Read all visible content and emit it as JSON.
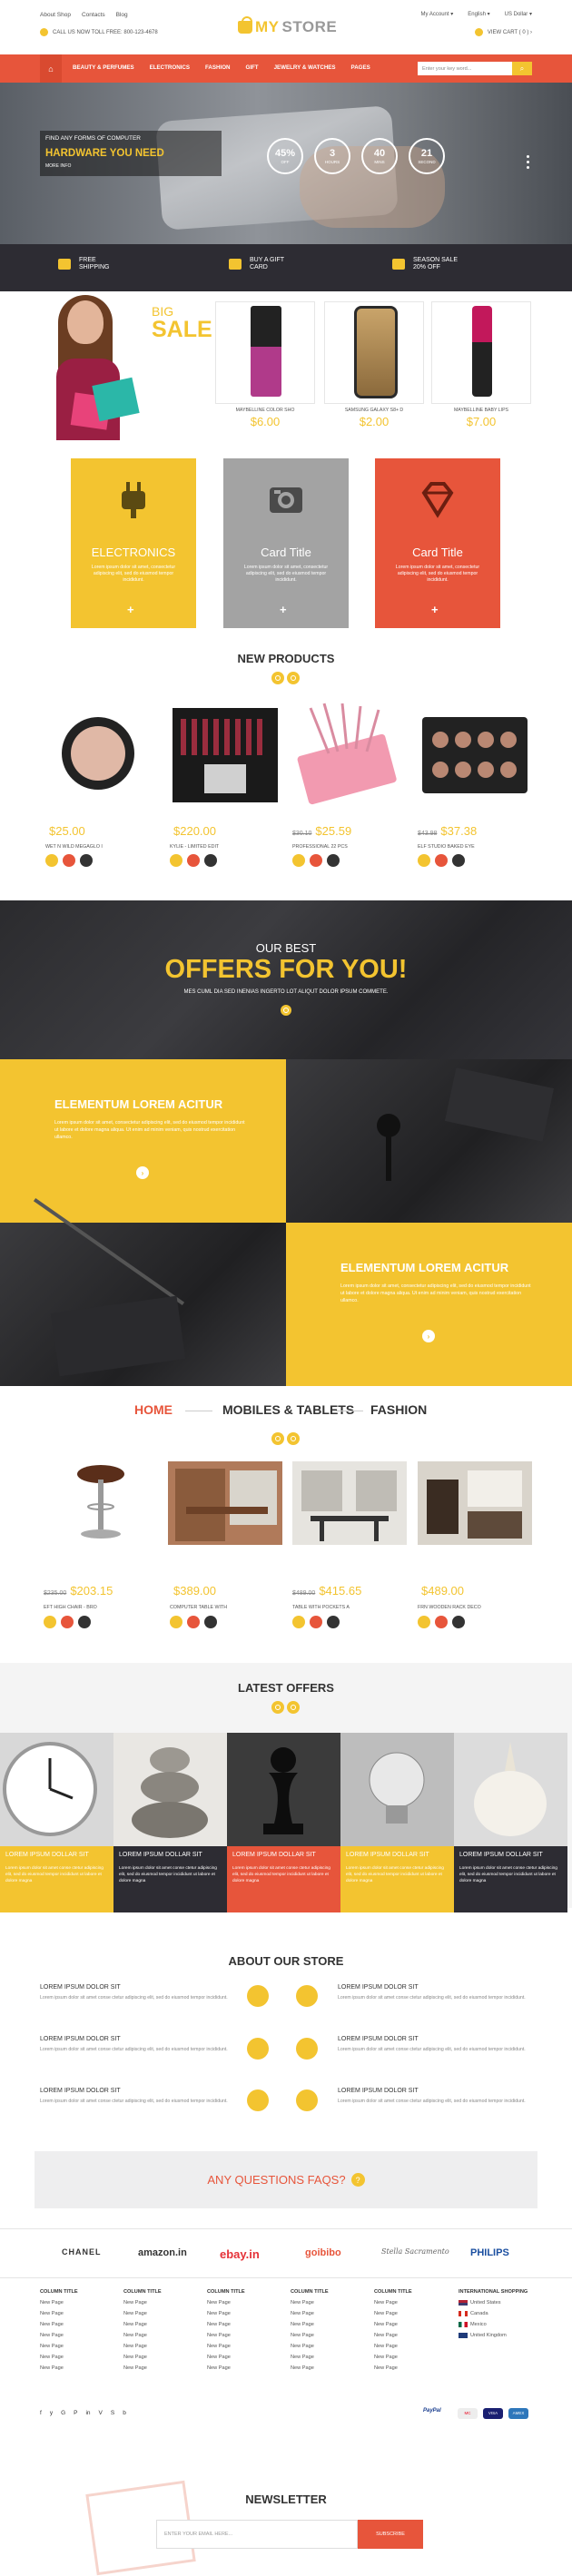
{
  "topbar": {
    "links": [
      "About Shop",
      "Contacts",
      "Blog"
    ],
    "call": "CALL US NOW TOLL FREE: 800-123-4678",
    "account": "My Account",
    "language": "English",
    "currency": "US Dollar",
    "cart": "VIEW CART ( 0 ) ›"
  },
  "logo": {
    "my": "MY",
    "store": "STORE"
  },
  "nav": {
    "home_icon": "home-icon",
    "items": [
      "BEAUTY & PERFUMES",
      "ELECTRONICS",
      "FASHION",
      "GIFT",
      "JEWELRY & WATCHES",
      "PAGES"
    ],
    "search_placeholder": "Enter your key word..."
  },
  "hero": {
    "line1": "FIND ANY FORMS OF COMPUTER",
    "line2": "HARDWARE YOU NEED",
    "line3": "MORE INFO",
    "countdown": [
      {
        "value": "45%",
        "label": "OFF"
      },
      {
        "value": "3",
        "label": "HOURS"
      },
      {
        "value": "40",
        "label": "MINS"
      },
      {
        "value": "21",
        "label": "SECOND"
      }
    ]
  },
  "shipping": [
    {
      "l1": "FREE",
      "l2": "SHIPPING"
    },
    {
      "l1": "BUY A GIFT",
      "l2": "CARD"
    },
    {
      "l1": "SEASON SALE",
      "l2": "20% OFF"
    }
  ],
  "bigsale": {
    "big": "BIG",
    "sale": "SALE",
    "products": [
      {
        "name": "MAYBELLINE COLOR SHO",
        "price": "$6.00"
      },
      {
        "name": "SAMSUNG GALAXY S8+ D",
        "price": "$2.00"
      },
      {
        "name": "MAYBELLINE BABY LIPS",
        "price": "$7.00"
      }
    ]
  },
  "categories": [
    {
      "title": "ELECTRONICS",
      "text": "Lorem ipsum dolor sit amet, consectetur adipiscing elit, sed do eiusmod tempor incididunt.",
      "color": "#f3c430",
      "plus": "+"
    },
    {
      "title": "Card Title",
      "text": "Lorem ipsum dolor sit amet, consectetur adipiscing elit, sed do eiusmod tempor incididunt.",
      "color": "#a0a0a0",
      "plus": "+"
    },
    {
      "title": "Card Title",
      "text": "Lorem ipsum dolor sit amet, consectetur adipiscing elit, sed do eiusmod tempor incididunt.",
      "color": "#e7553b",
      "plus": "+"
    }
  ],
  "new_products": {
    "title": "NEW PRODUCTS",
    "items": [
      {
        "old": "",
        "price": "$25.00",
        "name": "WET N WILD MEGAGLO I"
      },
      {
        "old": "",
        "price": "$220.00",
        "name": "KYLIE - LIMITED EDIT"
      },
      {
        "old": "$30.10",
        "price": "$25.59",
        "name": "PROFESSIONAL 22 PCS"
      },
      {
        "old": "$43.98",
        "price": "$37.38",
        "name": "ELF STUDIO BAKED EYE"
      }
    ]
  },
  "offers": {
    "sub": "OUR BEST",
    "title": "OFFERS FOR YOU!",
    "text": "MES CUML DIA SED INENIAS INGERTO LOT ALIQUT DOLOR IPSUM COMMETE."
  },
  "split": [
    {
      "title": "ELEMENTUM LOREM ACITUR",
      "text": "Lorem ipsum dolor sit amet, consectetur adipiscing elit, sed do eiusmod tempor incididunt ut labore et dolore magna aliqua. Ut enim ad minim veniam, quis nostrud exercitation ullamco."
    },
    {
      "title": "ELEMENTUM LOREM ACITUR",
      "text": "Lorem ipsum dolor sit amet, consectetur adipiscing elit, sed do eiusmod tempor incididunt ut labore et dolore magna aliqua. Ut enim ad minim veniam, quis nostrud exercitation ullamco."
    }
  ],
  "tabs": [
    "HOME",
    "MOBILES & TABLETS",
    "FASHION"
  ],
  "furniture": [
    {
      "old": "$235.00",
      "price": "$203.15",
      "name": "EFT HIGH CHAIR - BRO"
    },
    {
      "old": "",
      "price": "$389.00",
      "name": "COMPUTER TABLE WITH"
    },
    {
      "old": "$489.00",
      "price": "$415.65",
      "name": "TABLE WITH POCKETS A"
    },
    {
      "old": "",
      "price": "$489.00",
      "name": "FRN WOODEN RACK DECO"
    }
  ],
  "latest": {
    "title": "LATEST OFFERS",
    "items": [
      {
        "title": "LOREM IPSUM DOLLAR SIT",
        "text": "Lorem ipsum dolor sit amet conse ctetur adipiscing elit, sed do eiusmod tempor incididunt ut labore et dolore magna"
      },
      {
        "title": "LOREM IPSUM DOLLAR SIT",
        "text": "Lorem ipsum dolor sit amet conse ctetur adipiscing elit, sed do eiusmod tempor incididunt ut labore et dolore magna"
      },
      {
        "title": "LOREM IPSUM DOLLAR SIT",
        "text": "Lorem ipsum dolor sit amet conse ctetur adipiscing elit, sed do eiusmod tempor incididunt ut labore et dolore magna"
      },
      {
        "title": "LOREM IPSUM DOLLAR SIT",
        "text": "Lorem ipsum dolor sit amet conse ctetur adipiscing elit, sed do eiusmod tempor incididunt ut labore et dolore magna"
      },
      {
        "title": "LOREM IPSUM DOLLAR SIT",
        "text": "Lorem ipsum dolor sit amet conse ctetur adipiscing elit, sed do eiusmod tempor incididunt ut labore et dolore magna"
      }
    ]
  },
  "about": {
    "title": "ABOUT OUR STORE",
    "items": [
      {
        "title": "LOREM IPSUM DOLOR SIT",
        "text": "Lorem ipsum dolor sit amet conse ctetur adipiscing elit, sed do eiusmod tempor incididunt."
      },
      {
        "title": "LOREM IPSUM DOLOR SIT",
        "text": "Lorem ipsum dolor sit amet conse ctetur adipiscing elit, sed do eiusmod tempor incididunt."
      },
      {
        "title": "LOREM IPSUM DOLOR SIT",
        "text": "Lorem ipsum dolor sit amet conse ctetur adipiscing elit, sed do eiusmod tempor incididunt."
      },
      {
        "title": "LOREM IPSUM DOLOR SIT",
        "text": "Lorem ipsum dolor sit amet conse ctetur adipiscing elit, sed do eiusmod tempor incididunt."
      },
      {
        "title": "LOREM IPSUM DOLOR SIT",
        "text": "Lorem ipsum dolor sit amet conse ctetur adipiscing elit, sed do eiusmod tempor incididunt."
      },
      {
        "title": "LOREM IPSUM DOLOR SIT",
        "text": "Lorem ipsum dolor sit amet conse ctetur adipiscing elit, sed do eiusmod tempor incididunt."
      }
    ]
  },
  "faq": {
    "text": "ANY QUESTIONS FAQS?",
    "icon": "?"
  },
  "brands": [
    "CHANEL",
    "amazon.in",
    "ebay.in",
    "goibibo",
    "Stella Sacramento",
    "PHILIPS"
  ],
  "footer": {
    "columns": [
      {
        "title": "COLUMN TITLE",
        "links": [
          "New Page",
          "New Page",
          "New Page",
          "New Page",
          "New Page",
          "New Page",
          "New Page"
        ]
      },
      {
        "title": "COLUMN TITLE",
        "links": [
          "New Page",
          "New Page",
          "New Page",
          "New Page",
          "New Page",
          "New Page",
          "New Page"
        ]
      },
      {
        "title": "COLUMN TITLE",
        "links": [
          "New Page",
          "New Page",
          "New Page",
          "New Page",
          "New Page",
          "New Page",
          "New Page"
        ]
      },
      {
        "title": "COLUMN TITLE",
        "links": [
          "New Page",
          "New Page",
          "New Page",
          "New Page",
          "New Page",
          "New Page",
          "New Page"
        ]
      },
      {
        "title": "COLUMN TITLE",
        "links": [
          "New Page",
          "New Page",
          "New Page",
          "New Page",
          "New Page",
          "New Page",
          "New Page"
        ]
      }
    ],
    "intl_title": "INTERNATIONAL SHOPPING",
    "countries": [
      "United States",
      "Canada",
      "Mexico",
      "United Kingdom"
    ],
    "social": [
      "f",
      "y",
      "G",
      "P",
      "in",
      "V",
      "S",
      "b"
    ],
    "payments": [
      "PayPal",
      "MC",
      "VISA",
      "AMEX"
    ]
  },
  "newsletter": {
    "title": "NEWSLETTER",
    "placeholder": "ENTER YOUR EMAIL HERE...",
    "button": "SUBSCRIBE"
  }
}
